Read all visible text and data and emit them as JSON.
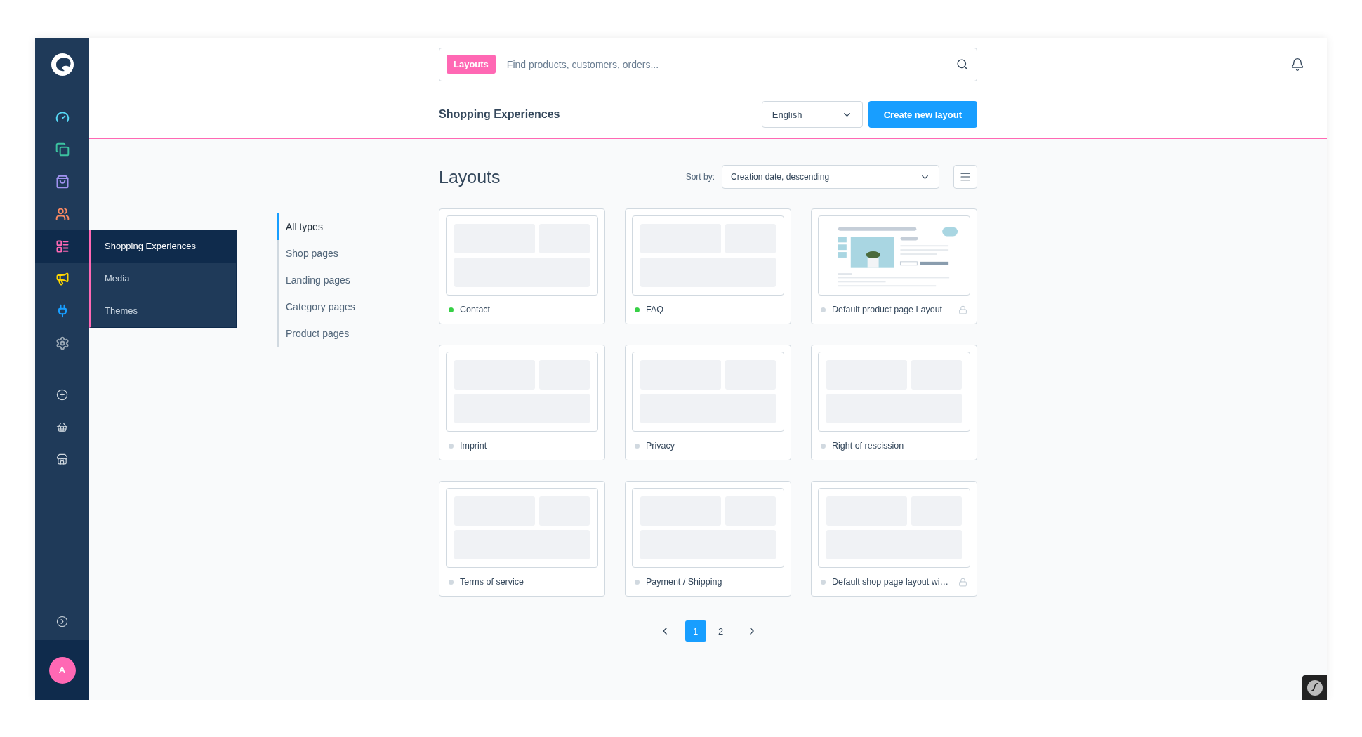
{
  "sidebar": {
    "items": [
      {
        "color": "#57d9f7",
        "selected": false
      },
      {
        "color": "#3cc2a0",
        "selected": false
      },
      {
        "color": "#a092f0",
        "selected": false
      },
      {
        "color": "#f88962",
        "selected": false
      },
      {
        "color": "#ff68b4",
        "selected": true
      },
      {
        "color": "#ffd700",
        "selected": false
      },
      {
        "color": "#189eff",
        "selected": false
      },
      {
        "color": "#9aa8b5",
        "selected": false
      }
    ],
    "user": {
      "initial": "A"
    }
  },
  "flyout": {
    "items": [
      {
        "label": "Shopping Experiences",
        "selected": true
      },
      {
        "label": "Media",
        "selected": false
      },
      {
        "label": "Themes",
        "selected": false
      }
    ]
  },
  "search": {
    "badge": "Layouts",
    "placeholder": "Find products, customers, orders..."
  },
  "header": {
    "title": "Shopping Experiences",
    "language": "English",
    "create_button": "Create new layout"
  },
  "filters": [
    {
      "label": "All types",
      "selected": true
    },
    {
      "label": "Shop pages",
      "selected": false
    },
    {
      "label": "Landing pages",
      "selected": false
    },
    {
      "label": "Category pages",
      "selected": false
    },
    {
      "label": "Product pages",
      "selected": false
    }
  ],
  "layouts": {
    "title": "Layouts",
    "sort_label": "Sort by:",
    "sort_value": "Creation date, descending",
    "cards": [
      {
        "name": "Contact",
        "active": true,
        "locked": false,
        "kind": "blank"
      },
      {
        "name": "FAQ",
        "active": true,
        "locked": false,
        "kind": "blank"
      },
      {
        "name": "Default product page Layout",
        "active": false,
        "locked": true,
        "kind": "product"
      },
      {
        "name": "Imprint",
        "active": false,
        "locked": false,
        "kind": "blank"
      },
      {
        "name": "Privacy",
        "active": false,
        "locked": false,
        "kind": "blank"
      },
      {
        "name": "Right of rescission",
        "active": false,
        "locked": false,
        "kind": "blank"
      },
      {
        "name": "Terms of service",
        "active": false,
        "locked": false,
        "kind": "blank"
      },
      {
        "name": "Payment / Shipping",
        "active": false,
        "locked": false,
        "kind": "blank"
      },
      {
        "name": "Default shop page layout wi…",
        "active": false,
        "locked": true,
        "kind": "blank"
      }
    ]
  },
  "pagination": {
    "pages": [
      {
        "label": "1",
        "selected": true
      },
      {
        "label": "2",
        "selected": false
      }
    ]
  }
}
